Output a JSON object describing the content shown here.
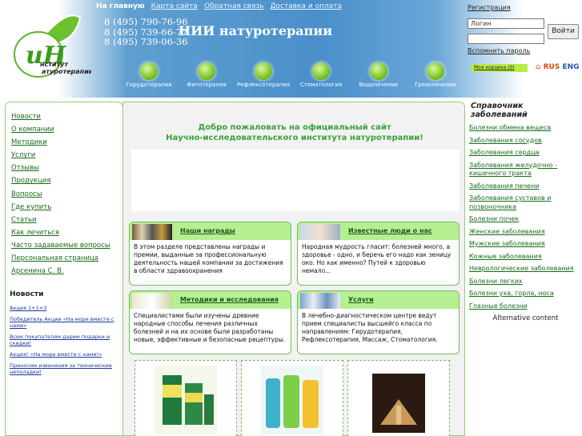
{
  "nav": {
    "current": "На главную",
    "links": [
      "Карта сайта",
      "Обратная связь",
      "Доставка и оплата"
    ]
  },
  "phones": [
    "8 (495) 790-76-96",
    "8 (495) 739-66-77",
    "8 (495) 739-06-36"
  ],
  "institute_name": "НИИ натуротерапии",
  "logo": {
    "letters": "иН",
    "line1": "нститут",
    "line2": "атуротерапии"
  },
  "login": {
    "register": "Регистрация",
    "login_placeholder": "Логин",
    "button": "Войти",
    "forgot": "Вспомнить пароль"
  },
  "categories": [
    "Гирудотерапия",
    "Фитотерапия",
    "Рефлексотерапия",
    "Стоматология",
    "Водолечение",
    "Грязелечение"
  ],
  "cart": "Моя корзина (0)",
  "langs": {
    "ru": "RUS",
    "en": "ENG"
  },
  "left_menu": [
    "Новости",
    "О компании",
    "Методики",
    "Услуги",
    "Отзывы",
    "Продукция",
    "Вопросы",
    "Где купить",
    "Статьи",
    "Как лечиться",
    "Часто задаваемые вопросы",
    "Персональная страница Арсенина С. В."
  ],
  "news_heading": "Новости",
  "news": [
    "Акция 1+1=3",
    "Победитель Акции «На море вместе с нами»",
    "Всем покупателям дарим подарки и скидки!",
    "Акция! «На море вместе с нами!»",
    "Приносим извинения за технические неполадки!"
  ],
  "welcome": {
    "line1": "Добро пожаловать на официальный сайт",
    "line2": "Научно-исследовательского института натуротерапии!"
  },
  "cards": [
    {
      "title": "Наши награды",
      "text": "В этом разделе представлены награды и премии, выданные за профессиональную деятельность нашей компании за достижения в области здравоохранения"
    },
    {
      "title": "Известные люди о нас",
      "text": "Народная мудрость гласит: болезней много, а здоровье - одно, и беречь его надо как зеницу око. Но как именно? Путей к здоровью немало..."
    },
    {
      "title": "Методики и исследования",
      "text": "Специалистами были изучены древние народные способы лечения различных болезней и на их основе были разработаны новые, эффективные и безопасные рецептуры."
    },
    {
      "title": "Услуги",
      "text": "В лечебно-диагностическом центре ведут прием специалисты высшейго класса по направлениям: Гирудотерапия, Рефлексотерапия, Массаж, Стоматология."
    }
  ],
  "right": {
    "heading": "Справочник заболеваний",
    "items": [
      "Болезни обмена вещесв",
      "Заболевания сосудов",
      "Заболевания сердца",
      "Заболевания желудочно - кишечного тракта",
      "Заболевания печени",
      "Заболевания суставов и позвоночника",
      "Болезни почек",
      "Женские заболевания",
      "Мужские заболевания",
      "Кожные заболевания",
      "Неврологические заболевания",
      "Болезни легких",
      "Болезни уха, горла, носа",
      "Глазные болезни"
    ],
    "alt": "Alternative content"
  }
}
